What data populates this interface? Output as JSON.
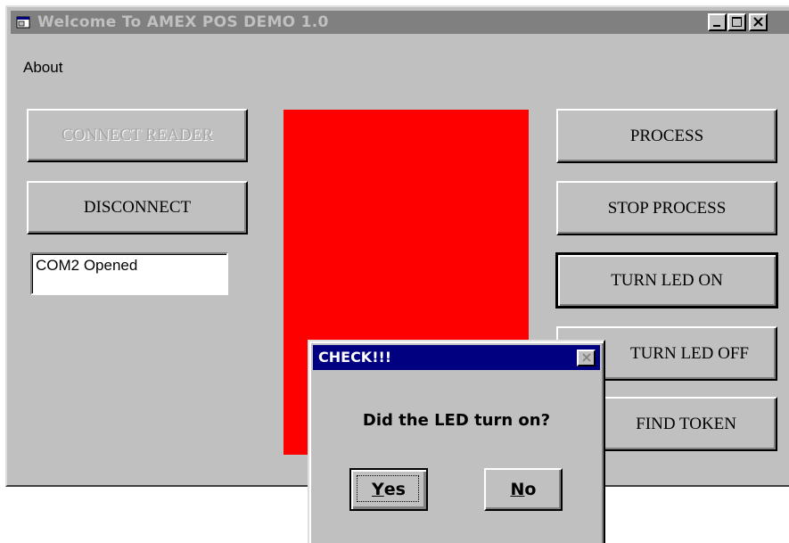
{
  "window": {
    "title": "Welcome To AMEX POS DEMO 1.0",
    "menu": [
      "About"
    ]
  },
  "left_buttons": {
    "connect": "CONNECT READER",
    "disconnect": "DISCONNECT"
  },
  "status_field": {
    "value": "COM2 Opened"
  },
  "led_indicator": {
    "color": "#ff0000"
  },
  "right_buttons": {
    "process": "PROCESS",
    "stop_process": "STOP PROCESS",
    "turn_led_on": "TURN LED ON",
    "turn_led_off": "TURN LED OFF",
    "find_token": "FIND TOKEN"
  },
  "dialog": {
    "title": "CHECK!!!",
    "message": "Did the LED turn on?",
    "yes_label_first": "Y",
    "yes_label_rest": "es",
    "no_label_first": "N",
    "no_label_rest": "o"
  },
  "colors": {
    "face": "#c0c0c0",
    "active_title": "#000080",
    "inactive_title": "#808080"
  }
}
